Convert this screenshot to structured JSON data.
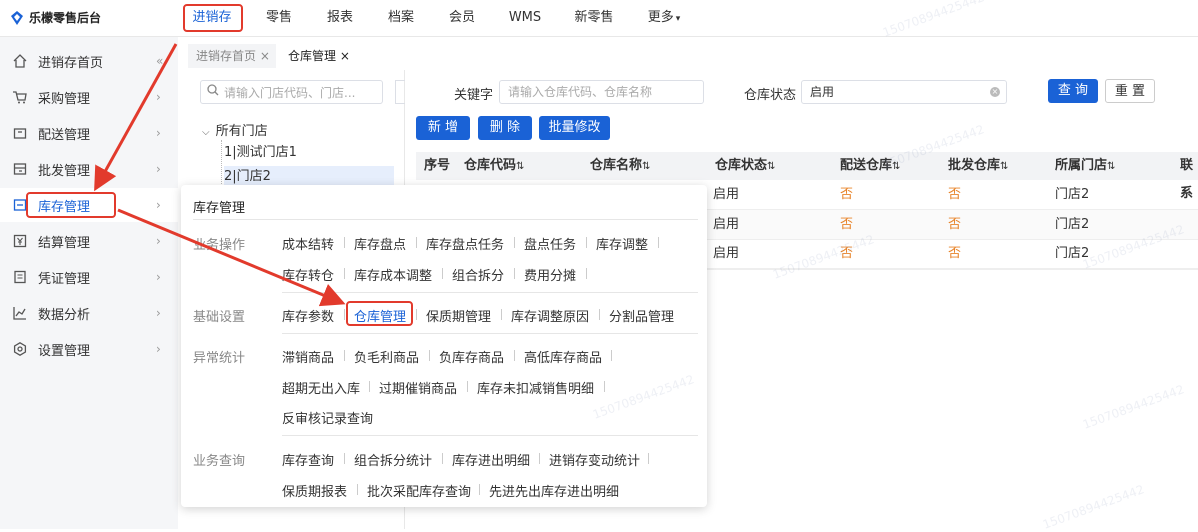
{
  "app": {
    "title": "乐檬零售后台"
  },
  "topnav": [
    {
      "label": "进销存",
      "active": true
    },
    {
      "label": "零售"
    },
    {
      "label": "报表"
    },
    {
      "label": "档案"
    },
    {
      "label": "会员"
    },
    {
      "label": "WMS"
    },
    {
      "label": "新零售"
    },
    {
      "label": "更多"
    }
  ],
  "sidebar": {
    "collapse_icon": "«",
    "items": [
      {
        "label": "进销存首页",
        "icon": "home-icon"
      },
      {
        "label": "采购管理",
        "icon": "cart-icon"
      },
      {
        "label": "配送管理",
        "icon": "box-icon"
      },
      {
        "label": "批发管理",
        "icon": "wholesale-icon"
      },
      {
        "label": "库存管理",
        "icon": "inventory-icon",
        "active": true
      },
      {
        "label": "结算管理",
        "icon": "yuan-icon"
      },
      {
        "label": "凭证管理",
        "icon": "document-icon"
      },
      {
        "label": "数据分析",
        "icon": "chart-icon"
      },
      {
        "label": "设置管理",
        "icon": "gear-icon"
      }
    ]
  },
  "tabs": [
    {
      "label": "进销存首页",
      "close": "×"
    },
    {
      "label": "仓库管理",
      "close": "×",
      "active": true
    }
  ],
  "tree": {
    "search_placeholder": "请输入门店代码、门店...",
    "root": "所有门店",
    "nodes": [
      "1|测试门店1",
      "2|门店2"
    ]
  },
  "filters": {
    "keyword_label": "关键字",
    "keyword_placeholder": "请输入仓库代码、仓库名称",
    "status_label": "仓库状态",
    "status_value": "启用",
    "query_button": "查 询",
    "reset_button": "重 置"
  },
  "actions": {
    "add": "新 增",
    "delete": "删 除",
    "batch_edit": "批量修改"
  },
  "table": {
    "columns": [
      "序号",
      "仓库代码",
      "仓库名称",
      "仓库状态",
      "配送仓库",
      "批发仓库",
      "所属门店",
      "联系"
    ],
    "rows": [
      {
        "status": "启用",
        "delivery": "否",
        "wholesale": "否",
        "store": "门店2"
      },
      {
        "status": "启用",
        "delivery": "否",
        "wholesale": "否",
        "store": "门店2"
      },
      {
        "status": "启用",
        "delivery": "否",
        "wholesale": "否",
        "store": "门店2"
      }
    ]
  },
  "popup": {
    "title": "库存管理",
    "sections": [
      {
        "label": "业务操作",
        "lines": [
          [
            "成本结转",
            "库存盘点",
            "库存盘点任务",
            "盘点任务",
            "库存调整"
          ],
          [
            "库存转仓",
            "库存成本调整",
            "组合拆分",
            "费用分摊"
          ]
        ]
      },
      {
        "label": "基础设置",
        "lines": [
          [
            "库存参数",
            "仓库管理",
            "保质期管理",
            "库存调整原因",
            "分割品管理"
          ]
        ]
      },
      {
        "label": "异常统计",
        "lines": [
          [
            "滞销商品",
            "负毛利商品",
            "负库存商品",
            "高低库存商品"
          ],
          [
            "超期无出入库",
            "过期催销商品",
            "库存未扣减销售明细"
          ],
          [
            "反审核记录查询"
          ]
        ]
      },
      {
        "label": "业务查询",
        "lines": [
          [
            "库存查询",
            "组合拆分统计",
            "库存进出明细",
            "进销存变动统计"
          ],
          [
            "保质期报表",
            "批次采配库存查询",
            "先进先出库存进出明细"
          ]
        ]
      }
    ]
  },
  "watermark": "15070894425442",
  "colors": {
    "accent": "#1a62d6",
    "highlight": "#e23a2c",
    "no_value": "#e8842a"
  }
}
